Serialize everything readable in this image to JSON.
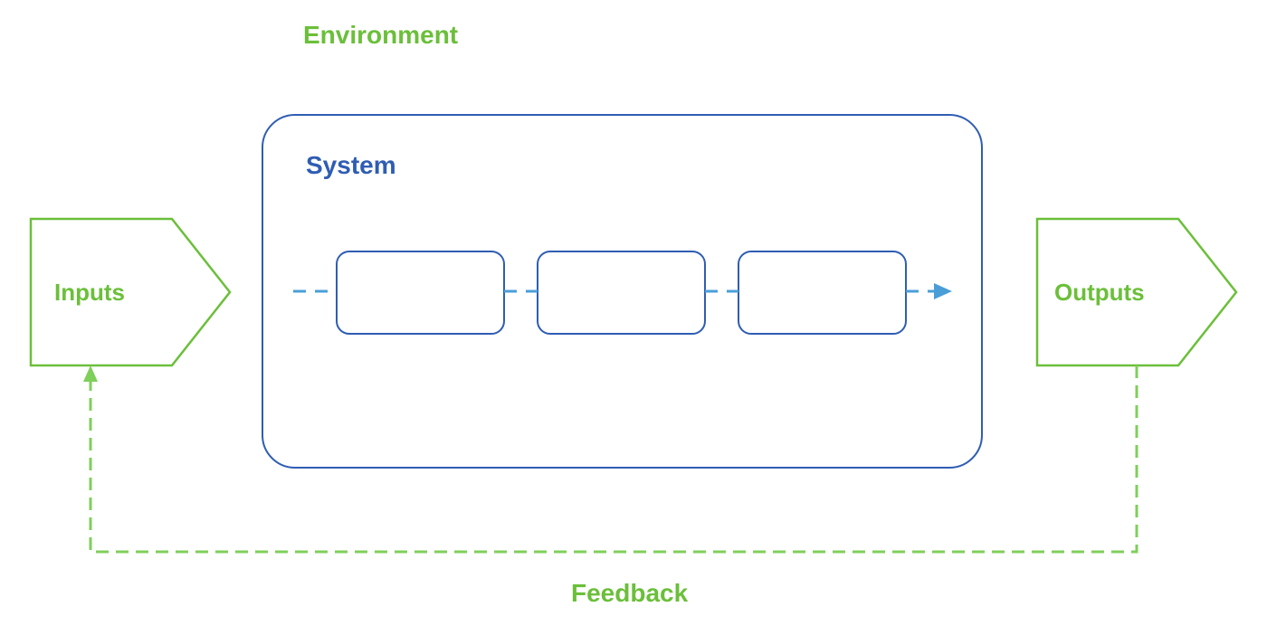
{
  "diagram": {
    "environment_label": "Environment",
    "system_label": "System",
    "inputs_label": "Inputs",
    "outputs_label": "Outputs",
    "feedback_label": "Feedback"
  },
  "colors": {
    "green": "#6bbf3a",
    "green_light": "#7fcf5b",
    "blue": "#2f5db3",
    "light_blue": "#4a9ed8"
  }
}
